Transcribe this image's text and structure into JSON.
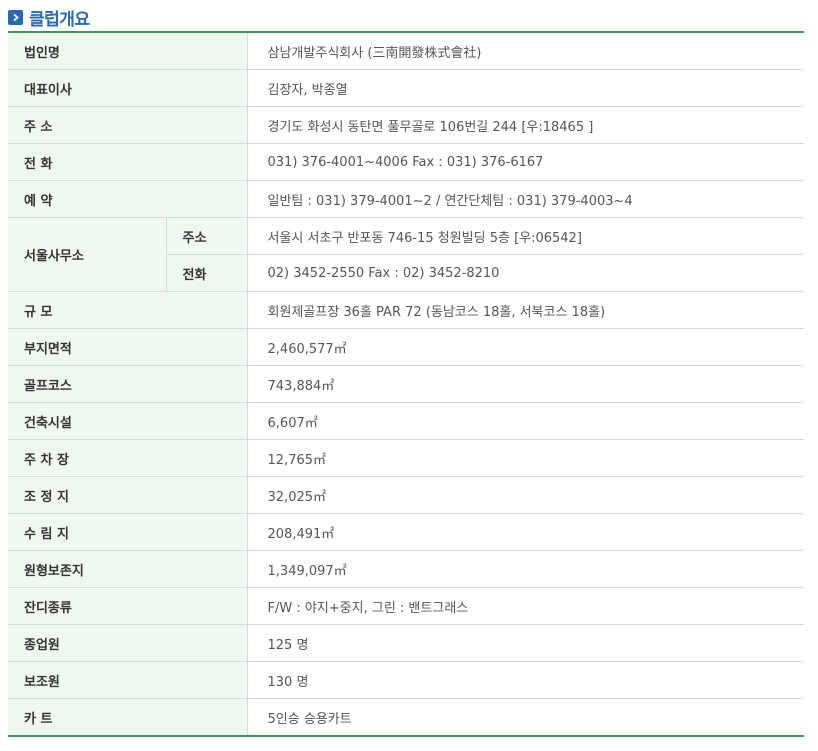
{
  "header": {
    "title": "클럽개요",
    "icon": "chevron-right-icon"
  },
  "colors": {
    "accent": "#2a67b3",
    "border": "#3a9a5a",
    "label_bg": "#eef8f0"
  },
  "rows": [
    {
      "label": "법인명",
      "value": "삼남개발주식회사 (三南開發株式會社)"
    },
    {
      "label": "대표이사",
      "value": "김장자, 박종열"
    },
    {
      "label": "주 소",
      "value": "경기도 화성시 동탄면 풀무골로 106번길 244 [우:18465 ]"
    },
    {
      "label": "전 화",
      "value": "031) 376-4001~4006 Fax : 031) 376-6167"
    },
    {
      "label": "예 약",
      "value": "일반팀 : 031) 379-4001~2 / 연간단체팀 : 031) 379-4003~4"
    },
    {
      "label": "서울사무소",
      "sub": [
        {
          "label": "주소",
          "value": "서울시 서초구 반포동 746-15 청원빌딩 5층 [우:06542]"
        },
        {
          "label": "전화",
          "value": "02) 3452-2550 Fax : 02) 3452-8210"
        }
      ]
    },
    {
      "label": "규 모",
      "value": "회원제골프장 36홀 PAR 72 (동남코스 18홀, 서북코스 18홀)"
    },
    {
      "label": "부지면적",
      "value": "2,460,577㎡"
    },
    {
      "label": "골프코스",
      "value": "743,884㎡"
    },
    {
      "label": "건축시설",
      "value": "6,607㎡"
    },
    {
      "label": "주 차 장",
      "value": "12,765㎡"
    },
    {
      "label": "조 정 지",
      "value": "32,025㎡"
    },
    {
      "label": "수 림 지",
      "value": "208,491㎡"
    },
    {
      "label": "원형보존지",
      "value": "1,349,097㎡"
    },
    {
      "label": "잔디종류",
      "value": "F/W : 야지+중지, 그린 : 밴트그래스"
    },
    {
      "label": "종업원",
      "value": "125 명"
    },
    {
      "label": "보조원",
      "value": "130 명"
    },
    {
      "label": "카 트",
      "value": "5인승 승용카트"
    }
  ]
}
